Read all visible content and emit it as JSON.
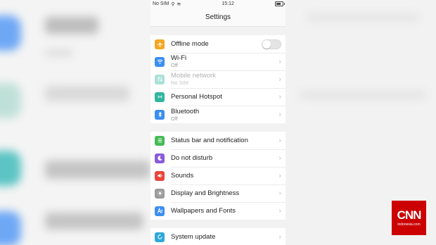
{
  "status_bar": {
    "carrier": "No SIM",
    "time": "15:12"
  },
  "header": {
    "title": "Settings"
  },
  "groups": [
    {
      "items": [
        {
          "label": "Offline mode",
          "icon": "airplane-icon",
          "color": "#f5a623",
          "toggle": "off"
        },
        {
          "label": "Wi-Fi",
          "sub": "Off",
          "icon": "wifi-icon",
          "color": "#3c8ef0"
        },
        {
          "label": "Mobile network",
          "sub": "No SIM",
          "icon": "mobile-network-icon",
          "color": "#2fb6a0",
          "disabled": true
        },
        {
          "label": "Personal Hotspot",
          "icon": "hotspot-icon",
          "color": "#2fb6a0"
        },
        {
          "label": "Bluetooth",
          "sub": "Off",
          "icon": "bluetooth-icon",
          "color": "#3c8ef0"
        }
      ]
    },
    {
      "items": [
        {
          "label": "Status bar and notification",
          "icon": "status-bar-icon",
          "color": "#44bb55"
        },
        {
          "label": "Do not disturb",
          "icon": "moon-icon",
          "color": "#8a5cd8"
        },
        {
          "label": "Sounds",
          "icon": "speaker-icon",
          "color": "#e8453c"
        },
        {
          "label": "Display and Brightness",
          "icon": "brightness-icon",
          "color": "#9b9b9b"
        },
        {
          "label": "Wallpapers and Fonts",
          "icon": "wallpaper-font-icon",
          "color": "#3c8ef0"
        }
      ]
    },
    {
      "items": [
        {
          "label": "System update",
          "icon": "update-icon",
          "color": "#2fa8d8"
        }
      ]
    }
  ],
  "logo": {
    "name": "CNN",
    "sub": "indonesia.com",
    "color": "#cc0000"
  }
}
